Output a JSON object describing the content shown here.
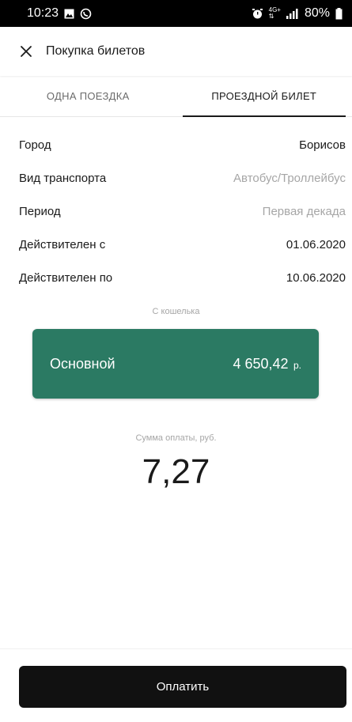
{
  "status_bar": {
    "time": "10:23",
    "network": "4G+",
    "battery": "80%"
  },
  "app_bar": {
    "close_icon": "close-icon",
    "title": "Покупка билетов"
  },
  "tabs": [
    {
      "label": "ОДНА ПОЕЗДКА",
      "active": false
    },
    {
      "label": "ПРОЕЗДНОЙ БИЛЕТ",
      "active": true
    }
  ],
  "info": [
    {
      "label": "Город",
      "value": "Борисов",
      "muted": false
    },
    {
      "label": "Вид транспорта",
      "value": "Автобус/Троллейбус",
      "muted": true
    },
    {
      "label": "Период",
      "value": "Первая декада",
      "muted": true
    },
    {
      "label": "Действителен с",
      "value": "01.06.2020",
      "muted": false
    },
    {
      "label": "Действителен по",
      "value": "10.06.2020",
      "muted": false
    }
  ],
  "wallet": {
    "caption": "С кошелька",
    "name": "Основной",
    "amount": "4 650,42",
    "currency": "р.",
    "color": "#2b7a63"
  },
  "sum": {
    "caption": "Сумма оплаты, руб.",
    "value": "7,27"
  },
  "pay_button": {
    "label": "Оплатить"
  }
}
